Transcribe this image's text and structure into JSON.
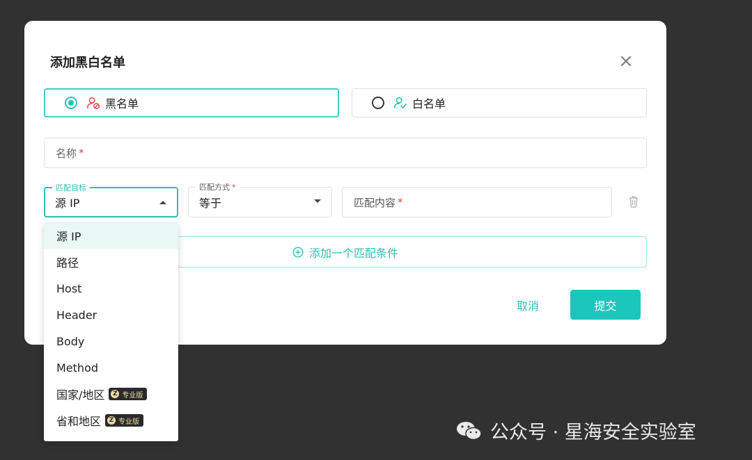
{
  "dialog": {
    "title": "添加黑白名单",
    "close_icon": "close-icon"
  },
  "list_type": {
    "black_label": "黑名单",
    "white_label": "白名单",
    "selected": "black"
  },
  "name_field": {
    "placeholder": "名称",
    "required_mark": "*"
  },
  "condition": {
    "target_label": "匹配目标",
    "target_value": "源 IP",
    "mode_label": "匹配方式",
    "mode_required": "*",
    "mode_value": "等于",
    "content_placeholder": "匹配内容",
    "content_required": "*"
  },
  "add_condition_label": "添加一个匹配条件",
  "actions": {
    "cancel": "取消",
    "submit": "提交"
  },
  "dropdown": {
    "items": [
      {
        "label": "源 IP",
        "selected": true
      },
      {
        "label": "路径"
      },
      {
        "label": "Host"
      },
      {
        "label": "Header"
      },
      {
        "label": "Body"
      },
      {
        "label": "Method"
      },
      {
        "label": "国家/地区",
        "badge": "专业版"
      },
      {
        "label": "省和地区",
        "badge": "专业版"
      }
    ]
  },
  "watermark": {
    "text": "公众号 · 星海安全实验室"
  },
  "colors": {
    "accent": "#2bbfb5",
    "submit_bg": "#1cc6bd",
    "required": "#e0454e",
    "backdrop": "#313131"
  }
}
